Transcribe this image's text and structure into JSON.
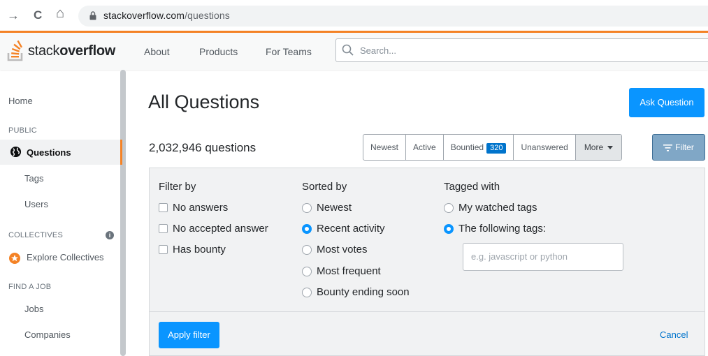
{
  "browser": {
    "back_glyph": "→",
    "reload_glyph": "C",
    "home_glyph": "⌂",
    "url_domain": "stackoverflow.com",
    "url_path": "/questions"
  },
  "topbar": {
    "logo_light": "stack",
    "logo_bold": "overflow",
    "nav": [
      "About",
      "Products",
      "For Teams"
    ],
    "search_placeholder": "Search..."
  },
  "sidebar": {
    "home": "Home",
    "public_heading": "PUBLIC",
    "questions": "Questions",
    "tags": "Tags",
    "users": "Users",
    "collectives_heading": "COLLECTIVES",
    "info_glyph": "i",
    "explore_collectives": "Explore Collectives",
    "find_job_heading": "FIND A JOB",
    "jobs": "Jobs",
    "companies": "Companies"
  },
  "main": {
    "title": "All Questions",
    "ask_button": "Ask Question",
    "question_count": "2,032,946 questions",
    "sort_tabs": {
      "newest": "Newest",
      "active": "Active",
      "bountied": "Bountied",
      "bountied_count": "320",
      "unanswered": "Unanswered",
      "more": "More"
    },
    "filter_button": "Filter"
  },
  "filter_panel": {
    "filter_by": {
      "heading": "Filter by",
      "options": [
        "No answers",
        "No accepted answer",
        "Has bounty"
      ]
    },
    "sorted_by": {
      "heading": "Sorted by",
      "options": [
        "Newest",
        "Recent activity",
        "Most votes",
        "Most frequent",
        "Bounty ending soon"
      ],
      "selected": "Recent activity"
    },
    "tagged_with": {
      "heading": "Tagged with",
      "options": [
        "My watched tags",
        "The following tags:"
      ],
      "selected": "The following tags:",
      "input_placeholder": "e.g. javascript or python"
    },
    "apply_button": "Apply filter",
    "cancel_link": "Cancel"
  },
  "colors": {
    "accent_orange": "#f48225",
    "primary_blue": "#0a95ff",
    "filter_active": "#80a7c6"
  }
}
